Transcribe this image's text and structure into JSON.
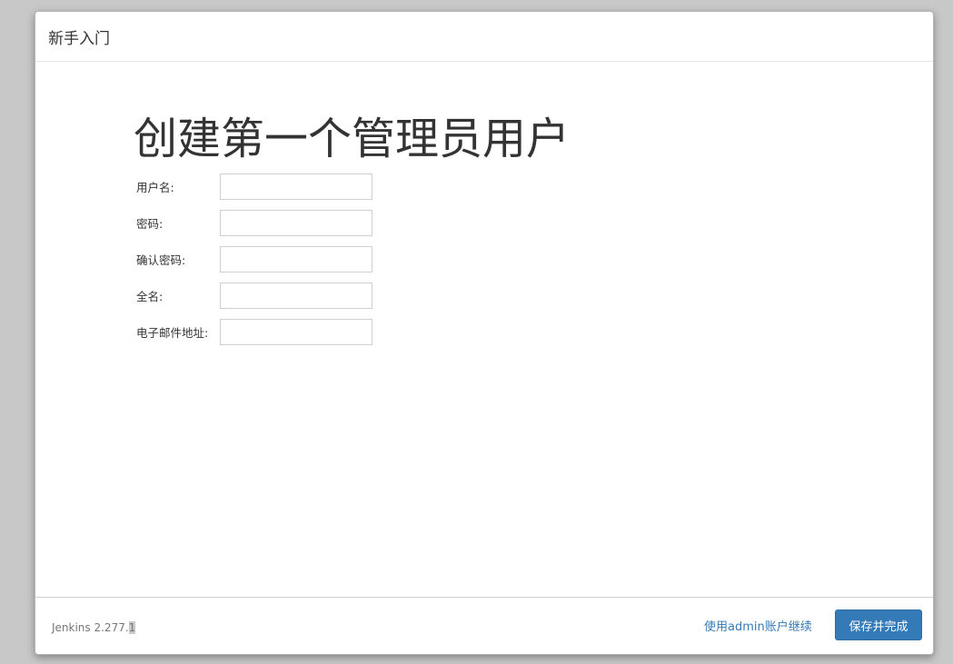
{
  "dialog": {
    "title": "新手入门"
  },
  "page": {
    "heading": "创建第一个管理员用户"
  },
  "form": {
    "fields": [
      {
        "label": "用户名:",
        "value": ""
      },
      {
        "label": "密码:",
        "value": ""
      },
      {
        "label": "确认密码:",
        "value": ""
      },
      {
        "label": "全名:",
        "value": ""
      },
      {
        "label": "电子邮件地址:",
        "value": ""
      }
    ]
  },
  "footer": {
    "version_prefix": "Jenkins 2.277.",
    "version_suffix": "1",
    "admin_link": "使用admin账户继续",
    "save_button": "保存并完成"
  },
  "colors": {
    "accent": "#337ab7",
    "backdrop": "#c8c8c8"
  }
}
